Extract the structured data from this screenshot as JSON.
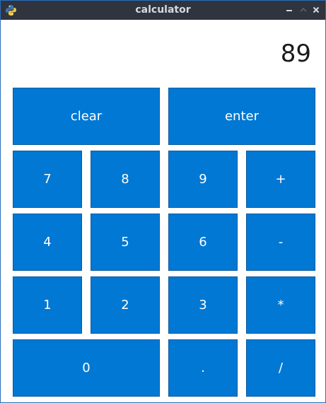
{
  "window": {
    "title": "calculator"
  },
  "display": {
    "value": "89"
  },
  "buttons": {
    "clear": "clear",
    "enter": "enter",
    "seven": "7",
    "eight": "8",
    "nine": "9",
    "plus": "+",
    "four": "4",
    "five": "5",
    "six": "6",
    "minus": "-",
    "one": "1",
    "two": "2",
    "three": "3",
    "multiply": "*",
    "zero": "0",
    "dot": ".",
    "divide": "/"
  },
  "colors": {
    "button_bg": "#0078d4",
    "button_text": "#ffffff",
    "titlebar_bg": "#2f343f",
    "titlebar_text": "#d3dae3"
  },
  "icons": {
    "app": "python-icon",
    "minimize": "minimize-icon",
    "maximize": "maximize-icon",
    "close": "close-icon"
  }
}
